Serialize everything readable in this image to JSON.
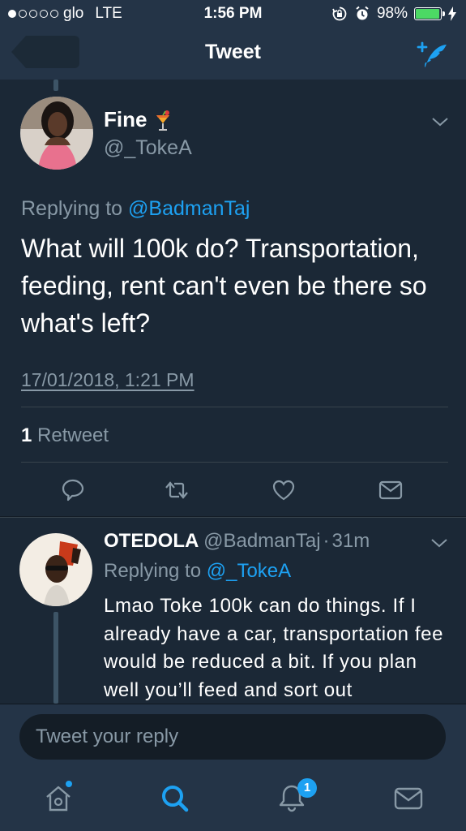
{
  "status_bar": {
    "carrier": "glo",
    "network": "LTE",
    "time": "1:56 PM",
    "battery": "98%",
    "battery_level": 0.98,
    "signal_bars_filled": 1,
    "signal_bars_total": 5,
    "icons": [
      "lock-rotation-icon",
      "alarm-icon",
      "charging-bolt-icon"
    ]
  },
  "nav": {
    "title": "Tweet",
    "back_icon": "back-arrow-icon",
    "compose_icon": "compose-tweet-icon"
  },
  "tweet": {
    "author_name": "Fine",
    "name_emoji": "cocktail-icon",
    "handle": "@_TokeA",
    "replying_prefix": "Replying to",
    "replying_to": "@BadmanTaj",
    "text": "What will 100k do? Transportation, feeding, rent can't even be there so what's left?",
    "timestamp": "17/01/2018, 1:21 PM",
    "retweet_count": "1",
    "retweet_label": "Retweet",
    "actions": [
      "reply-icon",
      "retweet-icon",
      "like-icon",
      "share-mail-icon"
    ]
  },
  "reply": {
    "author_name": "OTEDOLA",
    "handle": "@BadmanTaj",
    "separator": "·",
    "age": "31m",
    "replying_prefix": "Replying to",
    "replying_to": "@_TokeA",
    "text": "Lmao Toke 100k can do things. If I already have a car, transportation fee would be reduced a bit. If you plan well you’ll feed and sort out"
  },
  "composer": {
    "placeholder": "Tweet your reply"
  },
  "tabbar": {
    "tabs": [
      "home-icon",
      "search-icon",
      "notifications-icon",
      "messages-icon"
    ],
    "notifications_badge": "1"
  },
  "colors": {
    "background": "#141d26",
    "card": "#1b2836",
    "bar": "#243447",
    "accent": "#1da1f2",
    "secondary_text": "#8899a6"
  }
}
